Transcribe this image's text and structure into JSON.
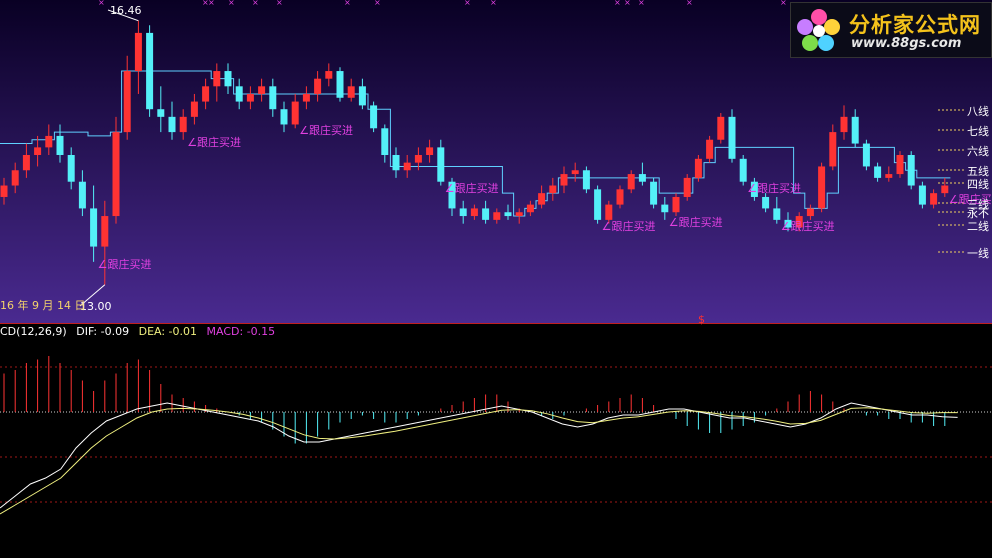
{
  "price_panel": {
    "high_label": "16.46",
    "low_label": "13.00",
    "date_label": "16 年 9 月 14 日",
    "signal_text": "跟庄买进",
    "level_labels": [
      "八线",
      "七线",
      "六线",
      "五线",
      "四线",
      "三线",
      "永不",
      "二线",
      "一线"
    ]
  },
  "macd_panel": {
    "name": "CD(12,26,9)",
    "dif_label": "DIF: -0.09",
    "dea_label": "DEA: -0.01",
    "macd_label": "MACD: -0.15",
    "marker": "$"
  },
  "logo": {
    "title": "分析家公式网",
    "url": "www.88gs.com"
  },
  "colors": {
    "up": "#ff3333",
    "down": "#54f0f8",
    "stair": "#5fd0ff",
    "signal": "#e040e0",
    "dif": "#ffffff",
    "dea": "#f0f080",
    "grid": "#c02020"
  },
  "chart_data": {
    "type": "candlestick",
    "high_marked": 16.46,
    "low_marked": 13.0,
    "ylim": [
      12.8,
      16.6
    ],
    "candles": [
      [
        14.15,
        14.4,
        14.05,
        14.3
      ],
      [
        14.3,
        14.6,
        14.2,
        14.5
      ],
      [
        14.5,
        14.85,
        14.4,
        14.7
      ],
      [
        14.7,
        14.95,
        14.55,
        14.8
      ],
      [
        14.8,
        15.1,
        14.7,
        14.95
      ],
      [
        14.95,
        15.1,
        14.6,
        14.7
      ],
      [
        14.7,
        14.8,
        14.25,
        14.35
      ],
      [
        14.35,
        14.5,
        13.9,
        14.0
      ],
      [
        14.0,
        14.3,
        13.3,
        13.5
      ],
      [
        13.5,
        14.1,
        13.0,
        13.9
      ],
      [
        13.9,
        15.2,
        13.8,
        15.0
      ],
      [
        15.0,
        16.0,
        14.9,
        15.8
      ],
      [
        15.8,
        16.46,
        15.5,
        16.3
      ],
      [
        16.3,
        16.4,
        15.2,
        15.3
      ],
      [
        15.3,
        15.6,
        15.0,
        15.2
      ],
      [
        15.2,
        15.4,
        14.9,
        15.0
      ],
      [
        15.0,
        15.3,
        14.9,
        15.2
      ],
      [
        15.2,
        15.5,
        15.1,
        15.4
      ],
      [
        15.4,
        15.7,
        15.3,
        15.6
      ],
      [
        15.6,
        15.9,
        15.4,
        15.8
      ],
      [
        15.8,
        15.9,
        15.5,
        15.6
      ],
      [
        15.6,
        15.7,
        15.3,
        15.4
      ],
      [
        15.4,
        15.6,
        15.3,
        15.5
      ],
      [
        15.5,
        15.7,
        15.4,
        15.6
      ],
      [
        15.6,
        15.7,
        15.2,
        15.3
      ],
      [
        15.3,
        15.4,
        15.0,
        15.1
      ],
      [
        15.1,
        15.5,
        15.05,
        15.4
      ],
      [
        15.4,
        15.6,
        15.3,
        15.5
      ],
      [
        15.5,
        15.8,
        15.4,
        15.7
      ],
      [
        15.7,
        15.9,
        15.6,
        15.8
      ],
      [
        15.8,
        15.85,
        15.4,
        15.45
      ],
      [
        15.45,
        15.7,
        15.4,
        15.6
      ],
      [
        15.6,
        15.7,
        15.3,
        15.35
      ],
      [
        15.35,
        15.4,
        15.0,
        15.05
      ],
      [
        15.05,
        15.1,
        14.6,
        14.7
      ],
      [
        14.7,
        14.8,
        14.4,
        14.5
      ],
      [
        14.5,
        14.7,
        14.4,
        14.6
      ],
      [
        14.6,
        14.8,
        14.5,
        14.7
      ],
      [
        14.7,
        14.9,
        14.6,
        14.8
      ],
      [
        14.8,
        14.9,
        14.3,
        14.35
      ],
      [
        14.35,
        14.4,
        13.9,
        14.0
      ],
      [
        14.0,
        14.1,
        13.8,
        13.9
      ],
      [
        13.9,
        14.05,
        13.85,
        14.0
      ],
      [
        14.0,
        14.1,
        13.8,
        13.85
      ],
      [
        13.85,
        14.0,
        13.8,
        13.95
      ],
      [
        13.95,
        14.05,
        13.85,
        13.9
      ],
      [
        13.9,
        14.0,
        13.8,
        13.95
      ],
      [
        13.95,
        14.1,
        13.9,
        14.05
      ],
      [
        14.05,
        14.3,
        14.0,
        14.2
      ],
      [
        14.2,
        14.4,
        14.1,
        14.3
      ],
      [
        14.3,
        14.55,
        14.2,
        14.45
      ],
      [
        14.45,
        14.6,
        14.35,
        14.5
      ],
      [
        14.5,
        14.55,
        14.2,
        14.25
      ],
      [
        14.25,
        14.3,
        13.8,
        13.85
      ],
      [
        13.85,
        14.1,
        13.8,
        14.05
      ],
      [
        14.05,
        14.3,
        14.0,
        14.25
      ],
      [
        14.25,
        14.5,
        14.2,
        14.45
      ],
      [
        14.45,
        14.6,
        14.3,
        14.35
      ],
      [
        14.35,
        14.4,
        14.0,
        14.05
      ],
      [
        14.05,
        14.15,
        13.85,
        13.95
      ],
      [
        13.95,
        14.2,
        13.9,
        14.15
      ],
      [
        14.15,
        14.45,
        14.1,
        14.4
      ],
      [
        14.4,
        14.7,
        14.35,
        14.65
      ],
      [
        14.65,
        14.95,
        14.6,
        14.9
      ],
      [
        14.9,
        15.25,
        14.85,
        15.2
      ],
      [
        15.2,
        15.3,
        14.6,
        14.65
      ],
      [
        14.65,
        14.7,
        14.3,
        14.35
      ],
      [
        14.35,
        14.4,
        14.1,
        14.15
      ],
      [
        14.15,
        14.2,
        13.95,
        14.0
      ],
      [
        14.0,
        14.15,
        13.8,
        13.85
      ],
      [
        13.85,
        13.95,
        13.7,
        13.75
      ],
      [
        13.75,
        13.95,
        13.7,
        13.9
      ],
      [
        13.9,
        14.05,
        13.85,
        14.0
      ],
      [
        14.0,
        14.6,
        13.95,
        14.55
      ],
      [
        14.55,
        15.1,
        14.5,
        15.0
      ],
      [
        15.0,
        15.35,
        14.9,
        15.2
      ],
      [
        15.2,
        15.3,
        14.8,
        14.85
      ],
      [
        14.85,
        14.9,
        14.5,
        14.55
      ],
      [
        14.55,
        14.6,
        14.35,
        14.4
      ],
      [
        14.4,
        14.55,
        14.35,
        14.45
      ],
      [
        14.45,
        14.75,
        14.4,
        14.7
      ],
      [
        14.7,
        14.75,
        14.25,
        14.3
      ],
      [
        14.3,
        14.35,
        14.0,
        14.05
      ],
      [
        14.05,
        14.25,
        14.0,
        14.2
      ],
      [
        14.2,
        14.4,
        14.15,
        14.3
      ]
    ],
    "stair_line": [
      14.85,
      14.85,
      14.85,
      14.9,
      14.9,
      15.0,
      15.0,
      15.0,
      14.95,
      14.95,
      15.0,
      15.8,
      15.8,
      15.8,
      15.8,
      15.8,
      15.8,
      15.8,
      15.8,
      15.7,
      15.7,
      15.5,
      15.5,
      15.5,
      15.5,
      15.5,
      15.5,
      15.5,
      15.5,
      15.5,
      15.5,
      15.5,
      15.5,
      15.3,
      15.3,
      14.55,
      14.55,
      14.55,
      14.55,
      14.55,
      14.55,
      14.55,
      14.55,
      14.55,
      14.55,
      14.2,
      13.9,
      14.0,
      14.1,
      14.2,
      14.4,
      14.4,
      14.4,
      14.4,
      14.4,
      14.4,
      14.4,
      14.4,
      14.4,
      14.2,
      14.2,
      14.2,
      14.4,
      14.6,
      14.8,
      14.8,
      14.8,
      14.8,
      14.8,
      14.8,
      14.8,
      14.2,
      14.0,
      14.0,
      14.2,
      14.8,
      14.8,
      14.8,
      14.8,
      14.8,
      14.6,
      14.5,
      14.4,
      14.4,
      14.4
    ],
    "signals_at": [
      8,
      16,
      26,
      39,
      53,
      59,
      66,
      69,
      84
    ],
    "macd": {
      "hist": [
        0.55,
        0.6,
        0.7,
        0.75,
        0.8,
        0.7,
        0.6,
        0.45,
        0.3,
        0.45,
        0.55,
        0.7,
        0.75,
        0.6,
        0.4,
        0.25,
        0.2,
        0.15,
        0.1,
        0.05,
        0.0,
        -0.05,
        -0.1,
        -0.15,
        -0.25,
        -0.35,
        -0.45,
        -0.45,
        -0.35,
        -0.25,
        -0.15,
        -0.1,
        -0.05,
        -0.1,
        -0.15,
        -0.15,
        -0.1,
        -0.05,
        0.0,
        0.05,
        0.1,
        0.15,
        0.2,
        0.25,
        0.25,
        0.15,
        0.05,
        0.0,
        -0.05,
        -0.1,
        -0.05,
        0.0,
        0.05,
        0.1,
        0.15,
        0.2,
        0.25,
        0.2,
        0.1,
        0.0,
        -0.1,
        -0.2,
        -0.25,
        -0.3,
        -0.3,
        -0.25,
        -0.2,
        -0.15,
        -0.05,
        0.05,
        0.15,
        0.25,
        0.3,
        0.25,
        0.15,
        0.05,
        0.0,
        -0.05,
        -0.05,
        -0.1,
        -0.1,
        -0.15,
        -0.15,
        -0.2,
        -0.2
      ],
      "dif": [
        -1.6,
        -1.4,
        -1.2,
        -1.1,
        -0.95,
        -0.6,
        -0.35,
        -0.15,
        -0.05,
        0.05,
        0.1,
        0.15,
        0.1,
        0.05,
        0.0,
        -0.05,
        -0.1,
        -0.15,
        -0.25,
        -0.4,
        -0.5,
        -0.5,
        -0.45,
        -0.4,
        -0.35,
        -0.3,
        -0.25,
        -0.2,
        -0.15,
        -0.1,
        -0.05,
        0.0,
        0.05,
        0.1,
        0.05,
        0.0,
        -0.1,
        -0.2,
        -0.25,
        -0.2,
        -0.1,
        -0.05,
        -0.05,
        0.0,
        0.05,
        0.05,
        0.0,
        -0.05,
        -0.1,
        -0.1,
        -0.15,
        -0.2,
        -0.25,
        -0.2,
        -0.1,
        0.05,
        0.15,
        0.1,
        0.05,
        0.0,
        -0.05,
        -0.05,
        -0.08,
        -0.09
      ],
      "dea": [
        -1.7,
        -1.55,
        -1.4,
        -1.25,
        -1.1,
        -0.85,
        -0.6,
        -0.4,
        -0.25,
        -0.1,
        0.0,
        0.05,
        0.06,
        0.05,
        0.03,
        0.0,
        -0.04,
        -0.1,
        -0.18,
        -0.28,
        -0.38,
        -0.44,
        -0.45,
        -0.43,
        -0.4,
        -0.36,
        -0.32,
        -0.27,
        -0.22,
        -0.17,
        -0.12,
        -0.07,
        -0.02,
        0.03,
        0.04,
        0.02,
        -0.03,
        -0.1,
        -0.16,
        -0.18,
        -0.14,
        -0.1,
        -0.08,
        -0.04,
        0.0,
        0.02,
        0.01,
        -0.02,
        -0.06,
        -0.08,
        -0.11,
        -0.15,
        -0.2,
        -0.19,
        -0.14,
        -0.04,
        0.06,
        0.07,
        0.05,
        0.02,
        -0.01,
        -0.02,
        -0.01,
        -0.01
      ]
    }
  }
}
